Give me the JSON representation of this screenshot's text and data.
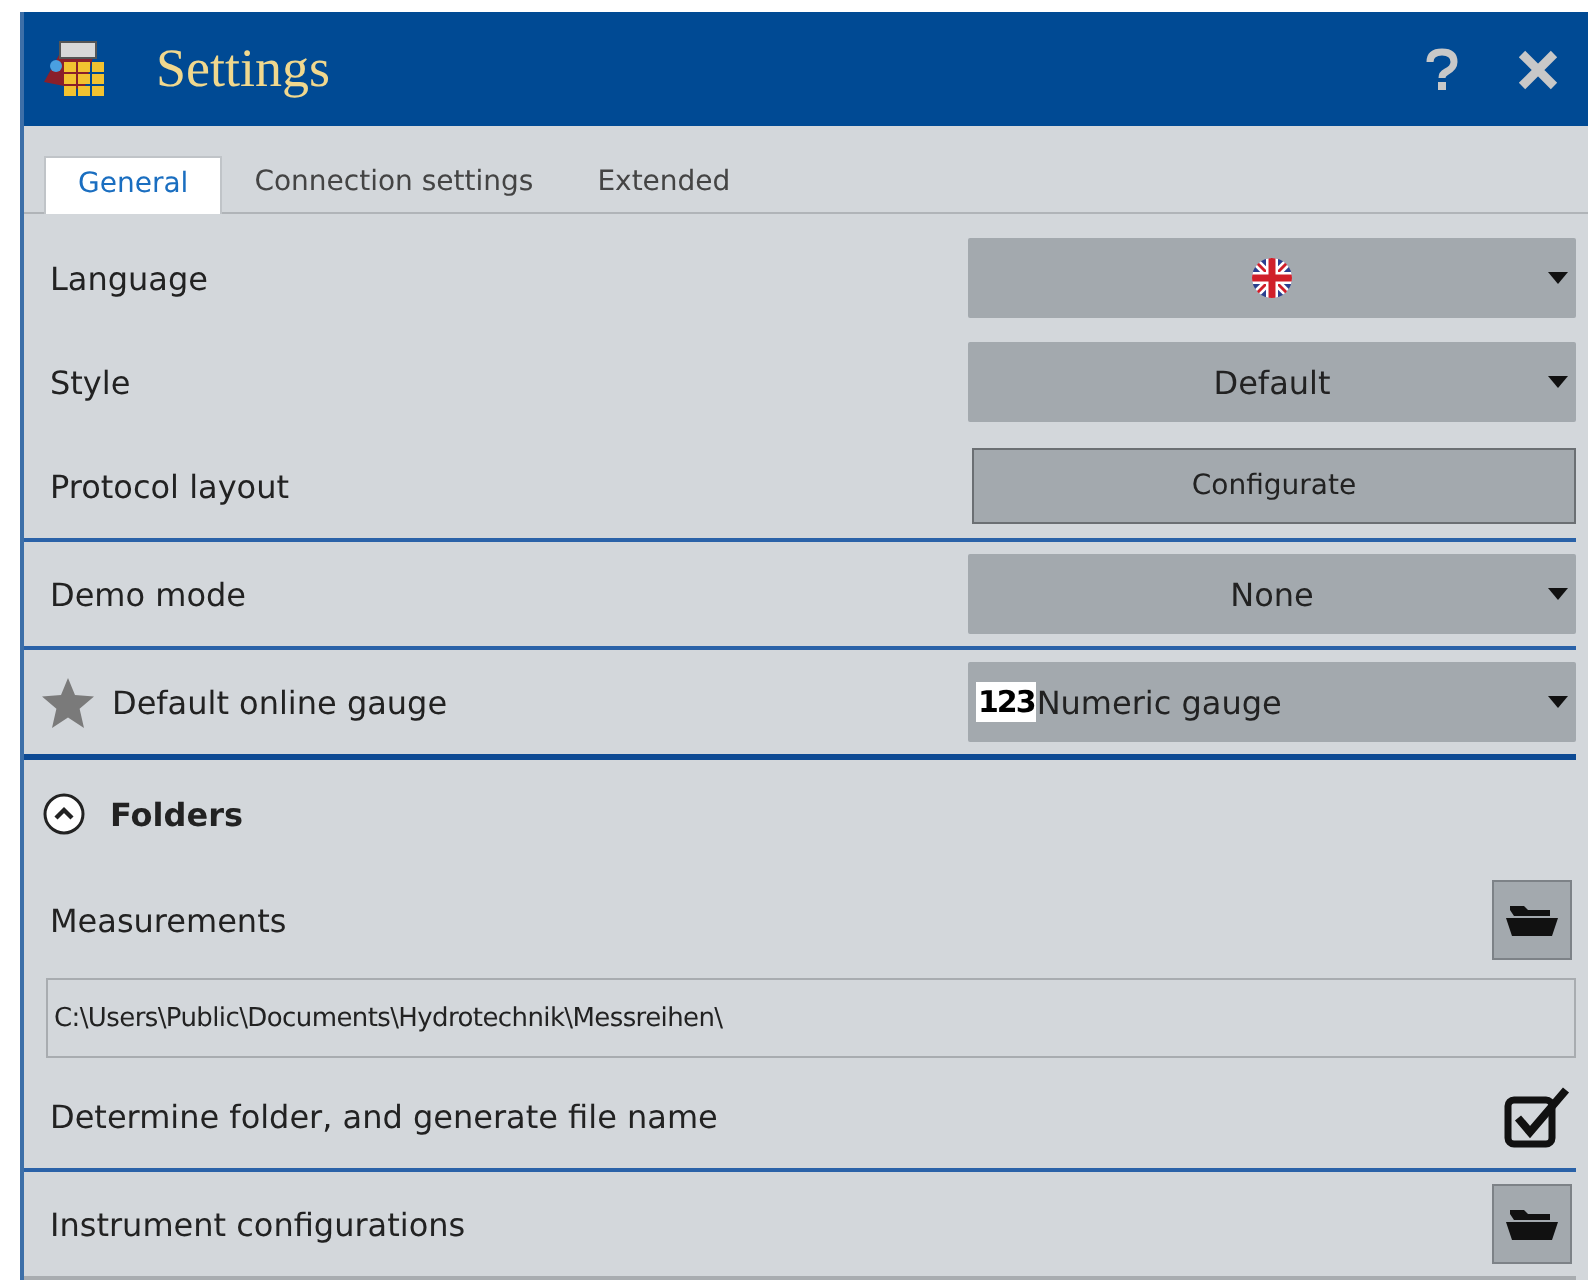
{
  "window": {
    "title": "Settings"
  },
  "tabs": [
    {
      "label": "General",
      "selected": true
    },
    {
      "label": "Connection settings",
      "selected": false
    },
    {
      "label": "Extended",
      "selected": false
    }
  ],
  "groups": [
    {
      "rows": [
        {
          "kind": "flag_dropdown",
          "label": "Language"
        },
        {
          "kind": "dropdown",
          "label": "Style",
          "value": "Default"
        },
        {
          "kind": "button",
          "label": "Protocol layout",
          "value": "Configurate"
        }
      ]
    },
    {
      "rows": [
        {
          "kind": "dropdown",
          "label": "Demo mode",
          "value": "None"
        }
      ]
    },
    {
      "rows": [
        {
          "kind": "star_dropdown",
          "label": "Default online gauge",
          "badge": "123",
          "value": "Numeric gauge"
        }
      ]
    }
  ],
  "folders": {
    "title": "Folders",
    "expanded": true,
    "groups": [
      {
        "rows": [
          {
            "kind": "folder",
            "label": "Measurements"
          },
          {
            "kind": "path",
            "value": "C:\\Users\\Public\\Documents\\Hydrotechnik\\Messreihen\\"
          },
          {
            "kind": "checkbox",
            "label": "Determine folder, and generate file name",
            "checked": true
          }
        ]
      },
      {
        "rows": [
          {
            "kind": "folder",
            "label": "Instrument configurations"
          }
        ]
      }
    ]
  }
}
